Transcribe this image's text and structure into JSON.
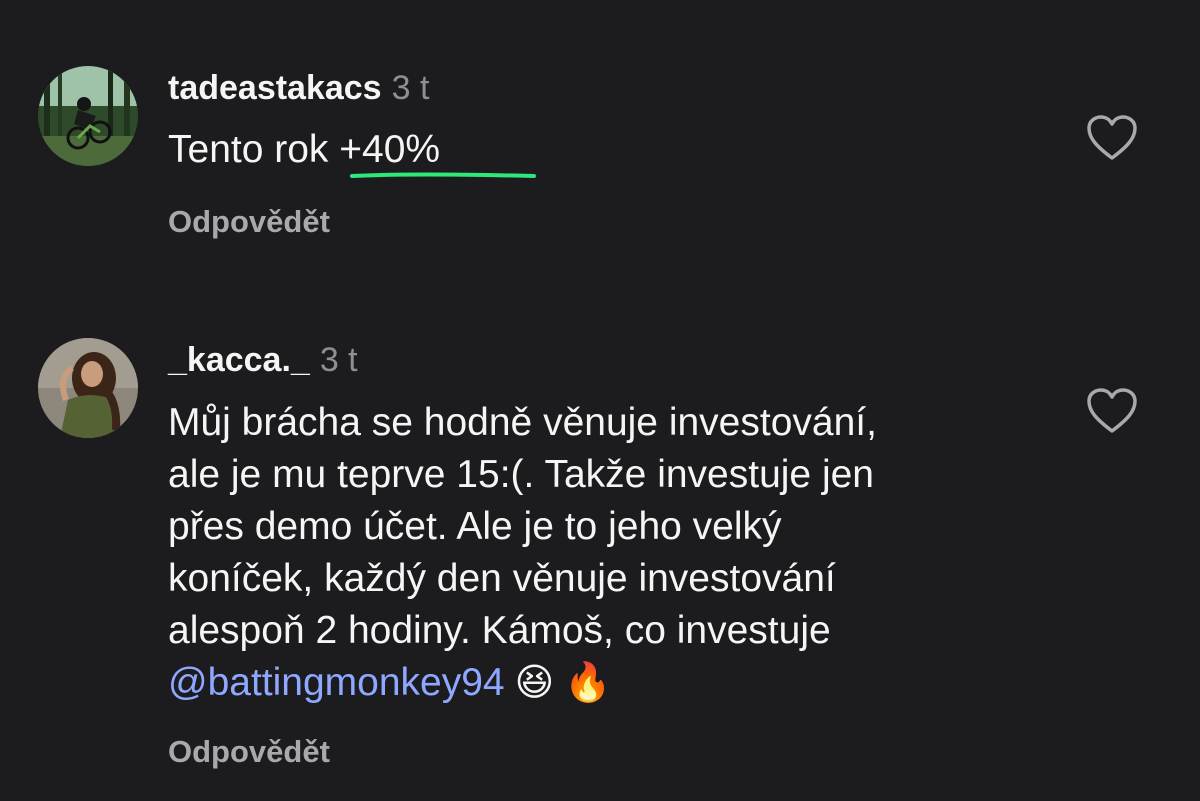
{
  "comments": [
    {
      "username": "tadeastakacs",
      "time": "3 t",
      "lines": [
        "Tento rok +40%"
      ],
      "reply_label": "Odpovědět",
      "like_icon": "heart-outline-icon",
      "avatar_icon": "mountain-bike-photo"
    },
    {
      "username": "_kacca._",
      "time": "3 t",
      "lines": [
        "Můj brácha se hodně věnuje investování,",
        "ale je mu teprve 15:(. Takže investuje jen",
        "přes demo účet. Ale je to jeho velký",
        "koníček, každý den věnuje investování",
        "alespoň 2 hodiny. Kámoš, co investuje"
      ],
      "mention": "@battingmonkey94",
      "emojis": [
        "😆",
        "🔥"
      ],
      "reply_label": "Odpovědět",
      "like_icon": "heart-outline-icon",
      "avatar_icon": "woman-portrait-photo"
    }
  ],
  "colors": {
    "background": "#1c1c1e",
    "text": "#f5f5f5",
    "muted": "#8e8e93",
    "mention": "#8fa8ff",
    "highlight_underline": "#2ee87a"
  }
}
